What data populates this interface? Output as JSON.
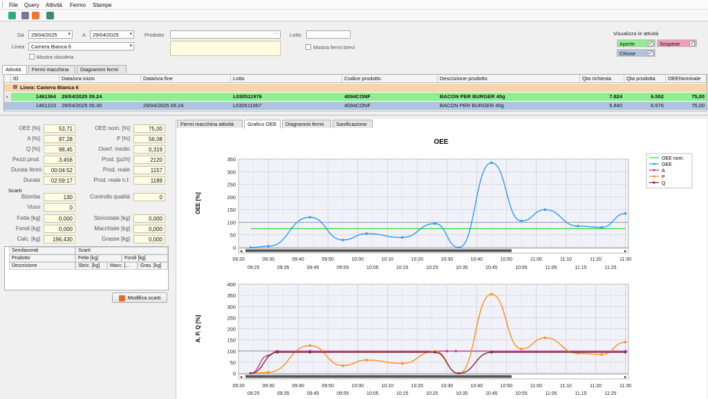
{
  "menu": [
    "File",
    "Query",
    "Attività",
    "Fermo",
    "Stampe"
  ],
  "filters": {
    "da_label": "Da",
    "da_value": "29/04/2025",
    "a_label": "A",
    "a_value": "29/04/2025",
    "prodotto_label": "Prodotto",
    "prodotto_value": "",
    "lotto_label": "Lotto",
    "lotto_value": "",
    "linea_label": "Linea",
    "linea_value": "Camera Bianca 6",
    "mostra_obsoleta": "Mostra obsoleta",
    "mostra_fermi_brevi": "Mostra fermi brevi"
  },
  "visualizza": {
    "title": "Visualizza le attività",
    "aperte": "Aperte",
    "sospese": "Sospese",
    "chiuse": "Chiuse",
    "colors": {
      "aperte": "#90ee90",
      "sospese": "#f0a0b8",
      "chiuse": "#b0c4de"
    }
  },
  "top_tabs": [
    "Attività",
    "Fermi macchina",
    "Diagrammi fermi"
  ],
  "grid": {
    "headers": [
      "ID",
      "Data/ora inizio",
      "Data/ora fine",
      "Lotto",
      "Codice prodotto",
      "Descrizione prodotto",
      "Qta richiesta",
      "Qta prodotta",
      "OEENominale"
    ],
    "group_label": "Linea: Camera Bianca 6",
    "rows": [
      {
        "id": "1461364",
        "inizio": "29/04/2025 09.24",
        "fine": "",
        "lotto": "L030511976",
        "codice": "4094CONF",
        "descr": "BACON PER BURGER 40g",
        "qta_rich": "7.824",
        "qta_prod": "6.552",
        "oee_nom": "75,00",
        "color": "#90ee90"
      },
      {
        "id": "1461223",
        "inizio": "29/04/2025 05.30",
        "fine": "29/04/2025 09.24",
        "lotto": "L030511967",
        "codice": "4094CONF",
        "descr": "BACON PER BURGER 40g",
        "qta_rich": "6.840",
        "qta_prod": "6.576",
        "oee_nom": "75,00",
        "color": "#b0c4de"
      }
    ]
  },
  "kpi": {
    "oee_label": "OEE [%]",
    "oee": "53,71",
    "oee_nom_label": "OEE nom. [%]",
    "oee_nom": "75,00",
    "a_label": "A [%]",
    "a": "97,28",
    "p_label": "P [%]",
    "p": "56,08",
    "q_label": "Q [%]",
    "q": "98,45",
    "overf_label": "Overf. medio",
    "overf": "0,319",
    "pezzi_label": "Pezzi prod.",
    "pezzi": "3.456",
    "prodpzh_label": "Prod. [pz/h]",
    "prodpzh": "2120",
    "durfermi_label": "Durata fermi",
    "durfermi": "00:04:52",
    "prodreale_label": "Prod. reale",
    "prodreale": "1157",
    "durata_label": "Durata",
    "durata": "02:59:17",
    "prodrealenf_label": "Prod. reale n.f.",
    "prodrealenf": "1189"
  },
  "scarti": {
    "title": "Scarti",
    "bizerba_label": "Bizerba",
    "bizerba": "130",
    "cq_label": "Controllo qualità",
    "cq": "0",
    "visivi_label": "Visivi",
    "visivi": "0",
    "fette_label": "Fette [kg]",
    "fette": "0,000",
    "sbric_label": "Sbriciolate [kg]",
    "sbric": "0,000",
    "fondi_label": "Fondi [kg]",
    "fondi": "0,000",
    "macch_label": "Macchiate [kg]",
    "macch": "0,000",
    "calc_label": "Calc. [kg]",
    "calc": "196,430",
    "grasse_label": "Grasse [kg]",
    "grasse": "0,000"
  },
  "semi": {
    "semilavorati": "Semilavorati",
    "scarti": "Scarti",
    "prodotto": "Prodotto",
    "fette": "Fette [kg]",
    "fondi": "Fondi [kg]",
    "descrizione": "Descrizione",
    "sbric": "Sbric. [kg]",
    "macc": "Macc. [...",
    "gras": "Gras. [kg]"
  },
  "modifica_button": "Modifica scarti",
  "right_tabs": [
    "Fermi macchina attività",
    "Grafico OEE",
    "Diagrammi fermi",
    "Sanificazione"
  ],
  "chart_data": [
    {
      "type": "line",
      "title": "OEE",
      "ylabel": "OEE [%]",
      "ylim": [
        0,
        350
      ],
      "yticks": [
        0,
        50,
        100,
        150,
        200,
        250,
        300,
        350
      ],
      "xticks_top": [
        "09:20",
        "09:30",
        "09:40",
        "09:50",
        "10:00",
        "10:10",
        "10:20",
        "10:30",
        "10:40",
        "10:50",
        "11:00",
        "11:10",
        "11:20",
        "11:30"
      ],
      "xticks_bottom": [
        "09:25",
        "09:35",
        "09:45",
        "09:55",
        "10:05",
        "10:15",
        "10:25",
        "10:35",
        "10:45",
        "10:55",
        "11:05",
        "11:15",
        "11:25"
      ],
      "legend": [
        "OEE nom.",
        "OEE",
        "A",
        "P",
        "Q"
      ],
      "legend_placement": "right",
      "series": [
        {
          "name": "OEE nom.",
          "color": "#33dd33",
          "x": [
            9.4,
            11.5
          ],
          "values": [
            75,
            75
          ]
        },
        {
          "name": "OEE",
          "color": "#3399ee",
          "x": [
            9.4,
            9.5,
            9.733,
            9.917,
            10.05,
            10.25,
            10.433,
            10.567,
            10.75,
            10.917,
            11.05,
            11.233,
            11.367,
            11.5
          ],
          "values": [
            0,
            5,
            120,
            30,
            55,
            40,
            95,
            0,
            335,
            105,
            150,
            85,
            80,
            135
          ]
        }
      ]
    },
    {
      "type": "line",
      "ylabel": "A, P, Q [%]",
      "ylim": [
        0,
        400
      ],
      "yticks": [
        0,
        50,
        100,
        150,
        200,
        250,
        300,
        350,
        400
      ],
      "xticks_top": [
        "09:20",
        "09:30",
        "09:40",
        "09:50",
        "10:00",
        "10:10",
        "10:20",
        "10:30",
        "10:40",
        "10:50",
        "11:00",
        "11:10",
        "11:20",
        "11:30"
      ],
      "xticks_bottom": [
        "09:25",
        "09:35",
        "09:45",
        "09:55",
        "10:05",
        "10:15",
        "10:25",
        "10:35",
        "10:45",
        "10:55",
        "11:05",
        "11:15",
        "11:25"
      ],
      "series": [
        {
          "name": "A",
          "color": "#cc3399",
          "x": [
            9.4,
            9.5,
            9.55,
            9.733,
            10.5,
            10.55,
            11.5
          ],
          "values": [
            0,
            80,
            100,
            100,
            100,
            100,
            100
          ]
        },
        {
          "name": "P",
          "color": "#ff8c1a",
          "x": [
            9.4,
            9.5,
            9.733,
            9.917,
            10.05,
            10.25,
            10.433,
            10.567,
            10.75,
            10.917,
            11.05,
            11.233,
            11.367,
            11.5
          ],
          "values": [
            0,
            5,
            125,
            35,
            60,
            45,
            100,
            0,
            355,
            110,
            160,
            90,
            85,
            140
          ]
        },
        {
          "name": "Q",
          "color": "#7a2a3a",
          "x": [
            9.4,
            9.55,
            9.733,
            10.433,
            10.567,
            10.75,
            11.5
          ],
          "values": [
            0,
            95,
            95,
            95,
            0,
            95,
            95
          ]
        }
      ]
    }
  ]
}
